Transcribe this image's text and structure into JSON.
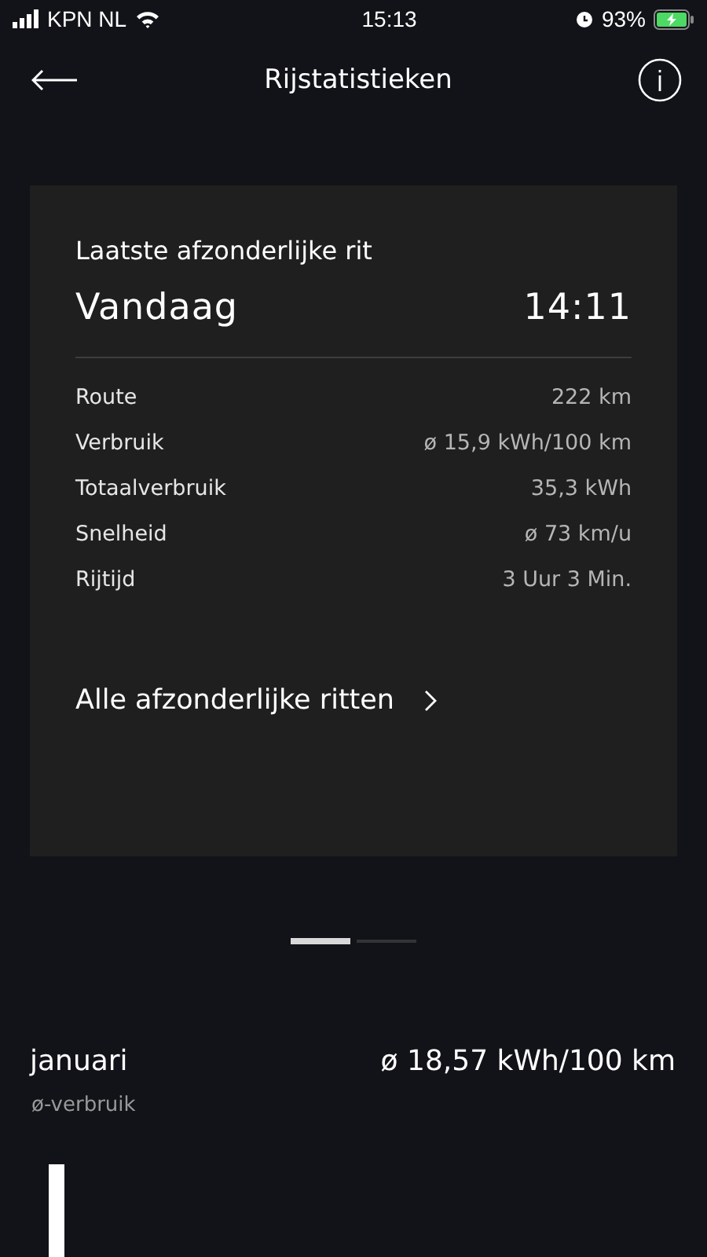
{
  "status_bar": {
    "carrier": "KPN NL",
    "time": "15:13",
    "battery": "93%"
  },
  "header": {
    "title": "Rijstatistieken"
  },
  "trip_card": {
    "heading": "Laatste afzonderlijke rit",
    "day": "Vandaag",
    "time": "14:11",
    "rows": [
      {
        "label": "Route",
        "value": "222 km"
      },
      {
        "label": "Verbruik",
        "value": "ø 15,9 kWh/100 km"
      },
      {
        "label": "Totaalverbruik",
        "value": "35,3 kWh"
      },
      {
        "label": "Snelheid",
        "value": "ø 73 km/u"
      },
      {
        "label": "Rijtijd",
        "value": "3 Uur 3 Min."
      }
    ],
    "link": "Alle afzonderlijke ritten"
  },
  "pages": [
    {
      "selected": true
    },
    {
      "selected": false
    }
  ],
  "monthly": {
    "month": "januari",
    "value": "ø 18,57 kWh/100 km",
    "caption": "ø-verbruik"
  }
}
